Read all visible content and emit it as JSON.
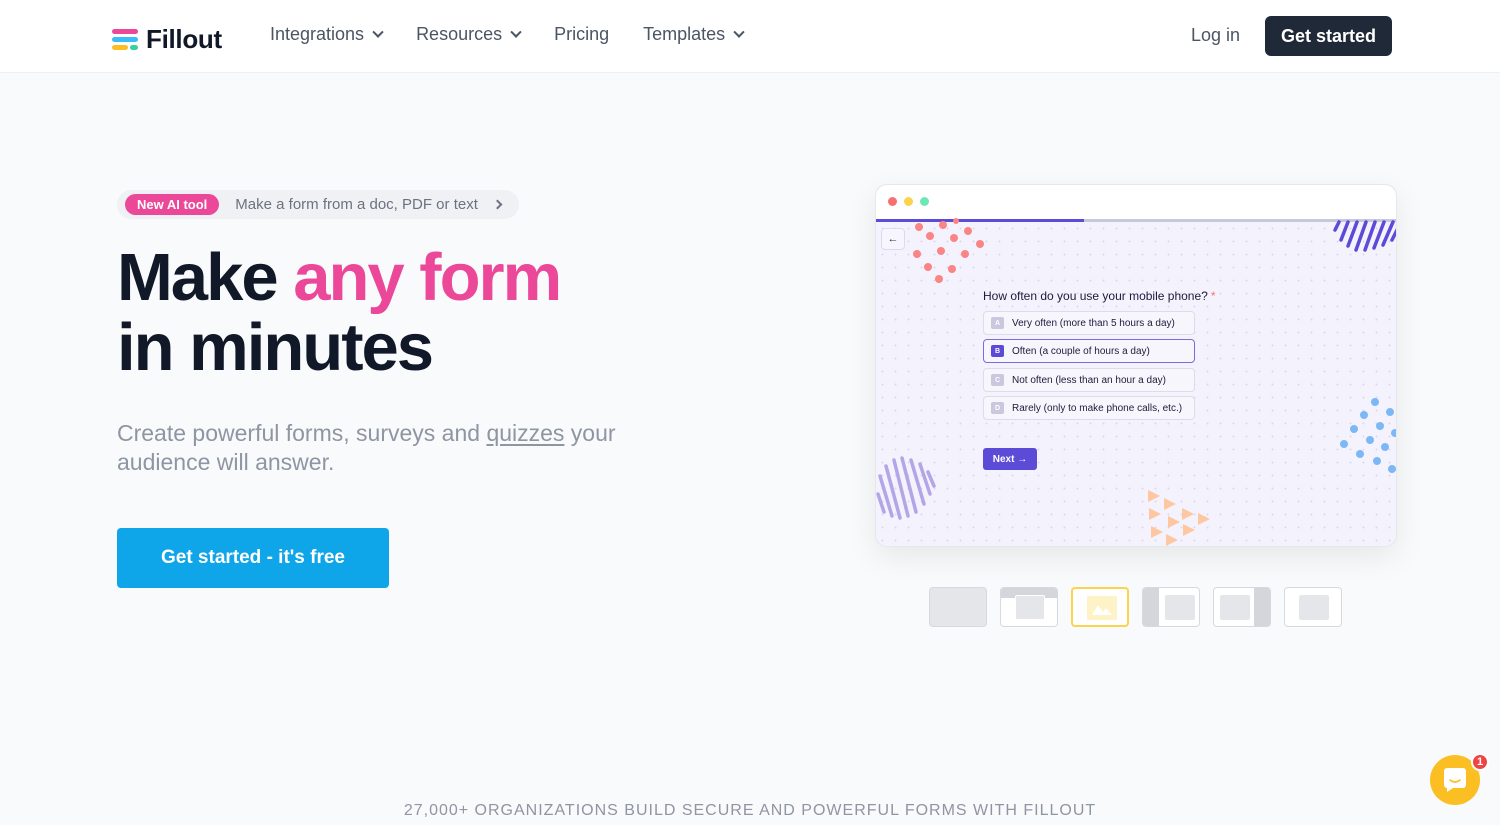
{
  "nav": {
    "brand": "Fillout",
    "links": [
      {
        "label": "Integrations",
        "has_dropdown": true
      },
      {
        "label": "Resources",
        "has_dropdown": true
      },
      {
        "label": "Pricing",
        "has_dropdown": false
      },
      {
        "label": "Templates",
        "has_dropdown": true
      }
    ],
    "login_label": "Log in",
    "cta_label": "Get started"
  },
  "hero": {
    "announcement": {
      "badge": "New AI tool",
      "text": "Make a form from a doc, PDF or text"
    },
    "title_part1": "Make ",
    "title_accent": "any form",
    "title_line2": "in minutes",
    "subtitle_before": "Create powerful forms, surveys and ",
    "subtitle_link": "quizzes",
    "subtitle_after": " your audience will answer.",
    "cta_label": "Get started - it's free"
  },
  "preview": {
    "back_icon": "←",
    "progress": 0.4,
    "question": "How often do you use your mobile phone?",
    "required_mark": "*",
    "options": [
      {
        "key": "A",
        "label": "Very often (more than 5 hours a day)",
        "selected": false
      },
      {
        "key": "B",
        "label": "Often (a couple of hours a day)",
        "selected": true
      },
      {
        "key": "C",
        "label": "Not often (less than an hour a day)",
        "selected": false
      },
      {
        "key": "D",
        "label": "Rarely (only to make phone calls, etc.)",
        "selected": false
      }
    ],
    "next_label": "Next →"
  },
  "layout_options": [
    "full",
    "top-banner",
    "image",
    "left-panel",
    "right-panel",
    "centered"
  ],
  "layout_selected_index": 2,
  "tagline": "27,000+ ORGANIZATIONS BUILD SECURE AND POWERFUL FORMS WITH FILLOUT",
  "chat": {
    "unread_count": "1"
  },
  "colors": {
    "accent_pink": "#ec4899",
    "cta_blue": "#0ea5e9",
    "dark": "#1f2937",
    "purple": "#5b4bd6",
    "yellow": "#fbbf24"
  }
}
